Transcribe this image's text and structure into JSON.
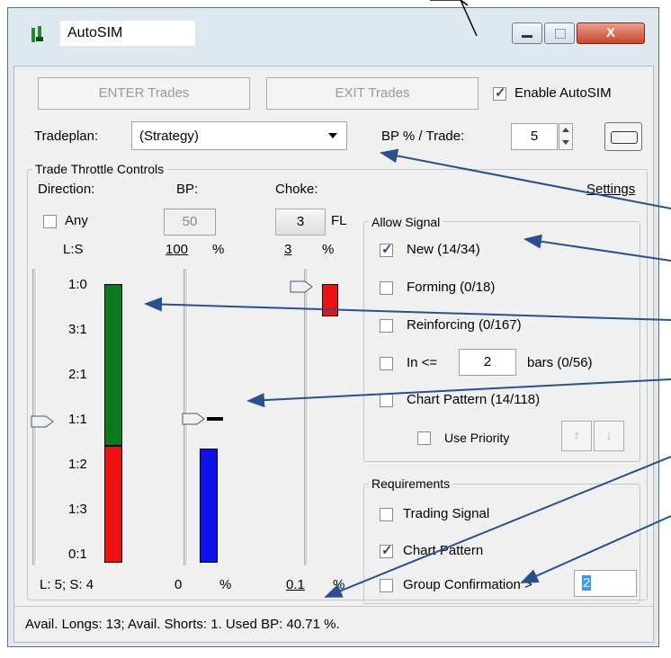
{
  "window": {
    "title": "AutoSIM",
    "close_glyph": "X"
  },
  "buttons": {
    "enter": "ENTER Trades",
    "exit": "EXIT Trades"
  },
  "enable_autosim": {
    "label": "Enable AutoSIM",
    "checked": true
  },
  "tradeplan": {
    "label": "Tradeplan:",
    "value": "(Strategy)"
  },
  "bp_trade": {
    "label": "BP % / Trade:",
    "value": "5"
  },
  "throttle": {
    "title": "Trade Throttle Controls",
    "direction_label": "Direction:",
    "bp_label": "BP:",
    "choke_label": "Choke:",
    "settings_link": "Settings",
    "any_label": "Any",
    "any_checked": false,
    "bp_input": "50",
    "choke_button": "3",
    "fl_label": "FL",
    "ls_label": "L:S",
    "bp_value": "100",
    "bp_pct": "%",
    "choke_value": "3",
    "choke_pct": "%",
    "ratio_ticks": [
      "1:0",
      "3:1",
      "2:1",
      "1:1",
      "1:2",
      "1:3",
      "0:1"
    ],
    "direction_long_fraction": 0.58,
    "bp_used_fraction": 0.41,
    "footer_direction": "L: 5; S: 4",
    "footer_bp": "0",
    "footer_bp_pct": "%",
    "footer_choke": "0.1",
    "footer_choke_pct": "%"
  },
  "allow_signal": {
    "title": "Allow Signal",
    "new": {
      "label": "New (14/34)",
      "checked": true
    },
    "forming": {
      "label": "Forming (0/18)",
      "checked": false
    },
    "reinforcing": {
      "label": "Reinforcing (0/167)",
      "checked": false
    },
    "in_prefix": "In <=",
    "in_value": "2",
    "in_suffix": "bars (0/56)",
    "chart_pattern": {
      "label": "Chart Pattern (14/118)",
      "checked": false
    },
    "use_priority": {
      "label": "Use Priority",
      "checked": false
    },
    "up_arrow": "↑",
    "down_arrow": "↓"
  },
  "requirements": {
    "title": "Requirements",
    "trading_signal": {
      "label": "Trading Signal",
      "checked": false
    },
    "chart_pattern": {
      "label": "Chart Pattern",
      "checked": true
    },
    "group_confirmation": {
      "label": "Group Confirmation >",
      "value": "2",
      "checked": false
    }
  },
  "status": "Avail. Longs: 13; Avail. Shorts: 1.  Used BP: 40.71 %.",
  "colors": {
    "long": "#0a7a1a",
    "short": "#ee1111",
    "bp": "#1010e8",
    "choke": "#ee1111",
    "arrow": "#2b4f8e"
  }
}
